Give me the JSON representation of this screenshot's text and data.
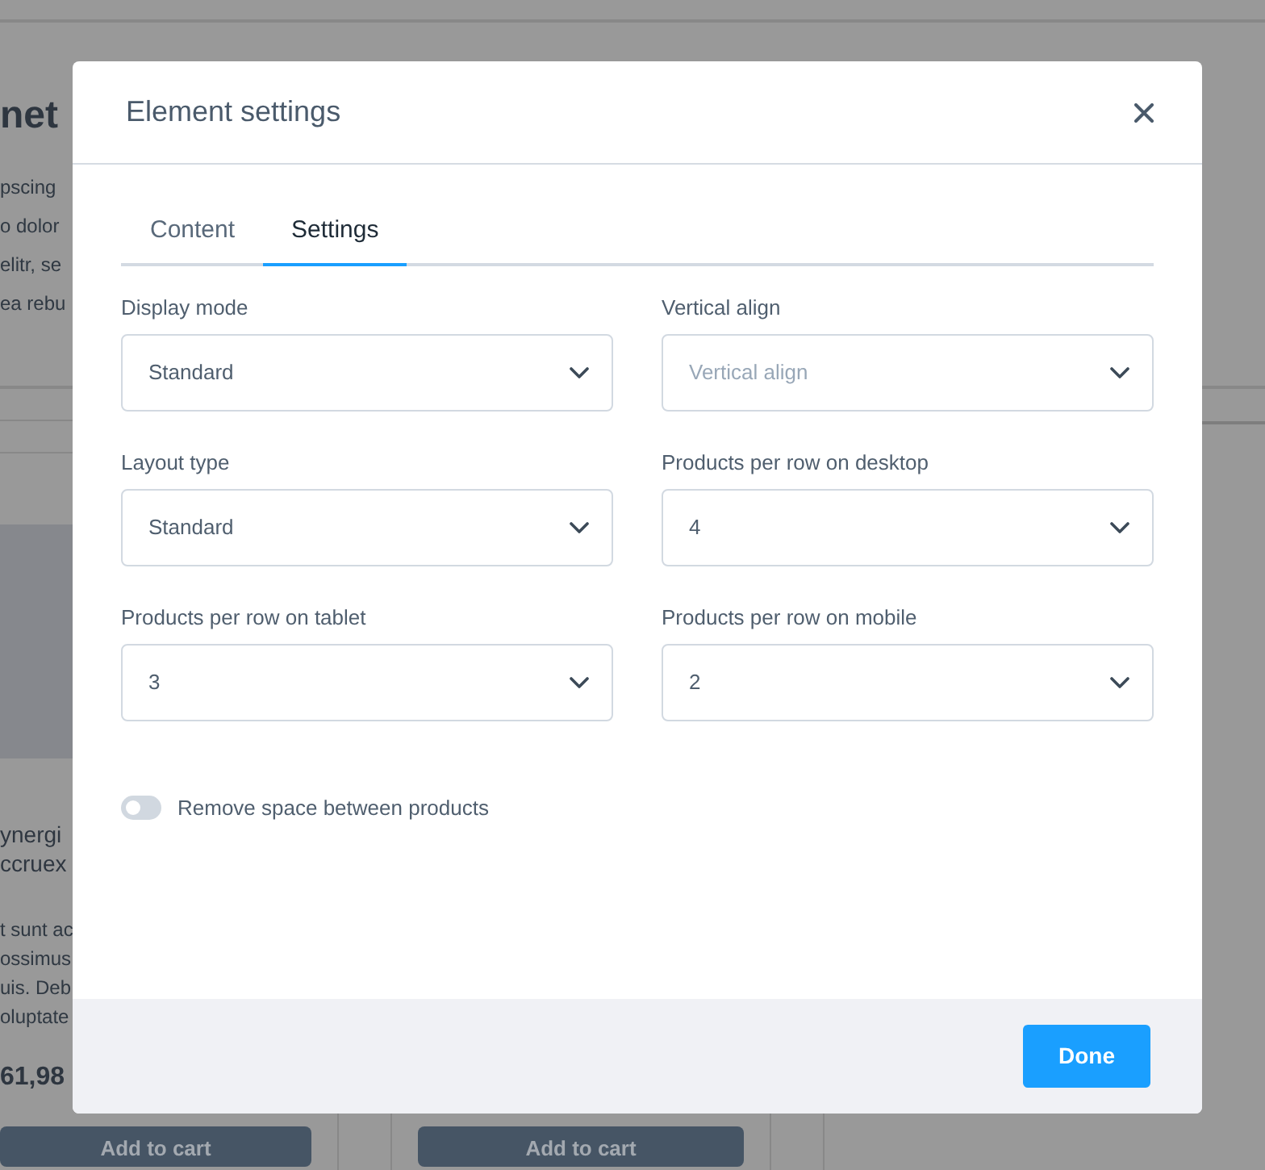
{
  "background": {
    "heading": "net",
    "intro_lines": [
      "pscing",
      "o dolor",
      "elitr, se",
      "ea rebu"
    ],
    "product_title_lines": [
      "ynergi",
      "ccruex"
    ],
    "product_description_lines": [
      "t sunt ac",
      "ossimus",
      "uis. Deb",
      "oluptate"
    ],
    "product_price": "61,98",
    "cart_buttons": [
      "Add to cart",
      "Add to cart"
    ]
  },
  "modal": {
    "title": "Element settings",
    "tabs": [
      {
        "label": "Content",
        "selected": false
      },
      {
        "label": "Settings",
        "selected": true
      }
    ],
    "fields": [
      {
        "label": "Display mode",
        "value": "Standard"
      },
      {
        "label": "Vertical align",
        "placeholder": "Vertical align"
      },
      {
        "label": "Layout type",
        "value": "Standard"
      },
      {
        "label": "Products per row on desktop",
        "value": "4"
      },
      {
        "label": "Products per row on tablet",
        "value": "3"
      },
      {
        "label": "Products per row on mobile",
        "value": "2"
      }
    ],
    "toggle": {
      "label": "Remove space between products",
      "on": false
    },
    "done_button": "Done"
  }
}
